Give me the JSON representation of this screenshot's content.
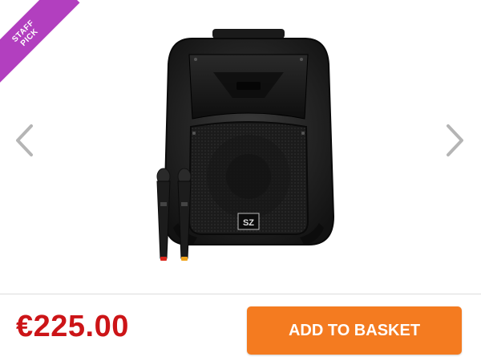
{
  "badge": {
    "line1": "STAFF",
    "line2": "PICK",
    "color": "#b23fbf"
  },
  "carousel": {
    "prev_icon": "chevron-left-icon",
    "next_icon": "chevron-right-icon"
  },
  "product": {
    "image_name": "portable-speaker-with-two-microphones",
    "logo_text": "SZ"
  },
  "purchase": {
    "price": "€225.00",
    "price_color": "#cc1417",
    "button_label": "ADD TO BASKET",
    "button_color": "#f47b20"
  }
}
